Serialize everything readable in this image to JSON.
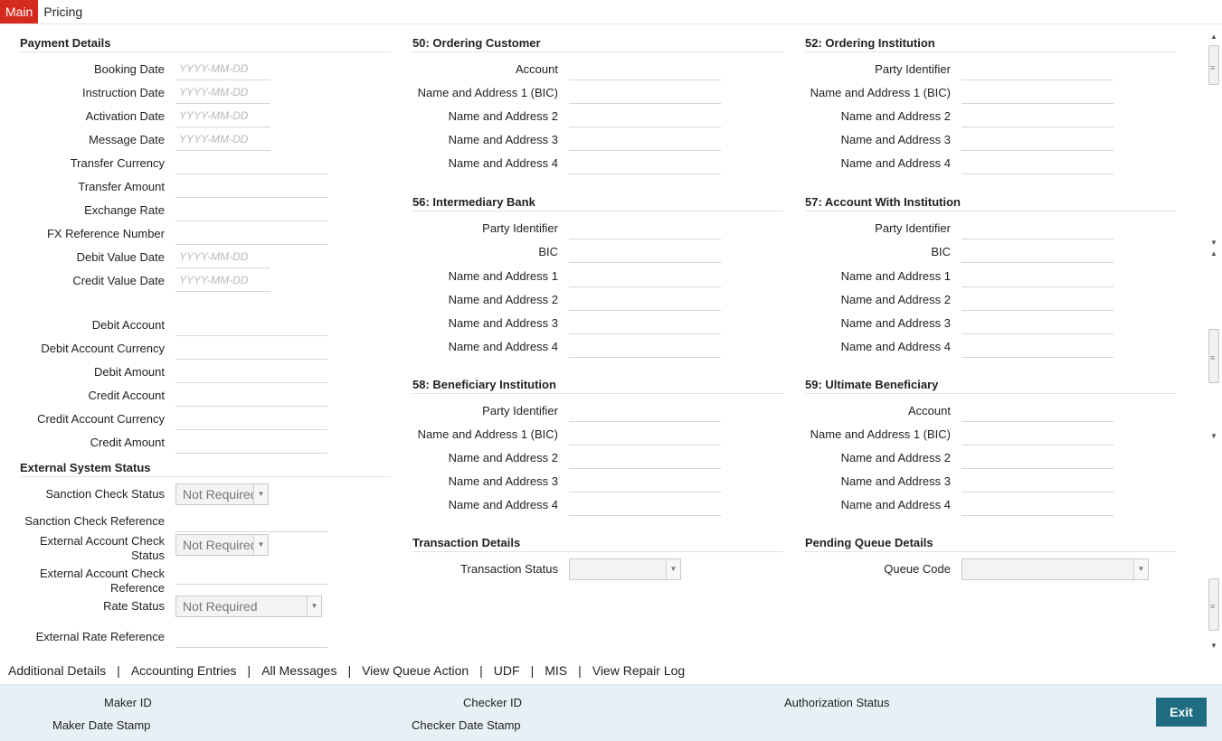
{
  "tabs": [
    {
      "label": "Main",
      "active": true
    },
    {
      "label": "Pricing",
      "active": false
    }
  ],
  "date_placeholder": "YYYY-MM-DD",
  "payment_details": {
    "title": "Payment Details",
    "booking_date": "Booking Date",
    "instruction_date": "Instruction Date",
    "activation_date": "Activation Date",
    "message_date": "Message Date",
    "transfer_currency": "Transfer Currency",
    "transfer_amount": "Transfer Amount",
    "exchange_rate": "Exchange Rate",
    "fx_reference_number": "FX Reference Number",
    "debit_value_date": "Debit Value Date",
    "credit_value_date": "Credit Value Date",
    "debit_account": "Debit Account",
    "debit_account_currency": "Debit Account Currency",
    "debit_amount": "Debit Amount",
    "credit_account": "Credit Account",
    "credit_account_currency": "Credit Account Currency",
    "credit_amount": "Credit Amount"
  },
  "external_system_status": {
    "title": "External System Status",
    "sanction_check_status": "Sanction Check Status",
    "sanction_check_status_value": "Not Required",
    "sanction_check_reference": "Sanction Check Reference",
    "external_account_check_status_1": "External Account Check",
    "external_account_check_status_2": "Status",
    "external_account_check_status_value": "Not Required",
    "external_account_check_reference_1": "External Account Check",
    "external_account_check_reference_2": "Reference",
    "rate_status": "Rate Status",
    "rate_status_value": "Not Required",
    "external_rate_reference": "External Rate Reference"
  },
  "ordering_customer": {
    "title": "50: Ordering Customer",
    "account": "Account",
    "name_address_1": "Name and Address 1 (BIC)",
    "name_address_2": "Name and Address 2",
    "name_address_3": "Name and Address 3",
    "name_address_4": "Name and Address 4"
  },
  "intermediary_bank": {
    "title": "56: Intermediary Bank",
    "party_identifier": "Party Identifier",
    "bic": "BIC",
    "name_address_1": "Name and Address 1",
    "name_address_2": "Name and Address 2",
    "name_address_3": "Name and Address 3",
    "name_address_4": "Name and Address 4"
  },
  "beneficiary_institution": {
    "title": "58: Beneficiary Institution",
    "party_identifier": "Party Identifier",
    "name_address_1": "Name and Address 1 (BIC)",
    "name_address_2": "Name and Address 2",
    "name_address_3": "Name and Address 3",
    "name_address_4": "Name and Address 4"
  },
  "transaction_details": {
    "title": "Transaction Details",
    "transaction_status": "Transaction Status"
  },
  "ordering_institution": {
    "title": "52: Ordering Institution",
    "party_identifier": "Party Identifier",
    "name_address_1": "Name and Address 1 (BIC)",
    "name_address_2": "Name and Address 2",
    "name_address_3": "Name and Address 3",
    "name_address_4": "Name and Address 4"
  },
  "account_with_institution": {
    "title": "57: Account With Institution",
    "party_identifier": "Party Identifier",
    "bic": "BIC",
    "name_address_1": "Name and Address 1",
    "name_address_2": "Name and Address 2",
    "name_address_3": "Name and Address 3",
    "name_address_4": "Name and Address 4"
  },
  "ultimate_beneficiary": {
    "title": "59: Ultimate Beneficiary",
    "account": "Account",
    "name_address_1": "Name and Address 1 (BIC)",
    "name_address_2": "Name and Address 2",
    "name_address_3": "Name and Address 3",
    "name_address_4": "Name and Address 4"
  },
  "pending_queue_details": {
    "title": "Pending Queue Details",
    "queue_code": "Queue Code"
  },
  "footer_links": {
    "additional_details": "Additional Details",
    "accounting_entries": "Accounting Entries",
    "all_messages": "All Messages",
    "view_queue_action": "View Queue Action",
    "udf": "UDF",
    "mis": "MIS",
    "view_repair_log": "View Repair Log",
    "separator": "|"
  },
  "audit": {
    "maker_id": "Maker ID",
    "maker_date_stamp": "Maker Date Stamp",
    "checker_id": "Checker ID",
    "checker_date_stamp": "Checker Date Stamp",
    "authorization_status": "Authorization Status",
    "exit_label": "Exit"
  }
}
